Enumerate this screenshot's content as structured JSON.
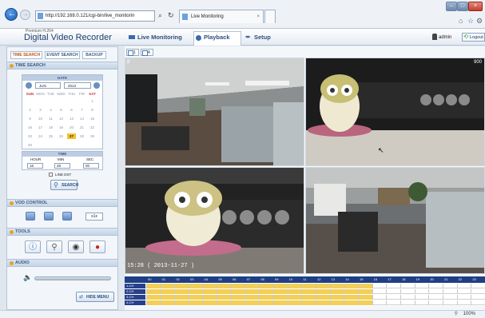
{
  "browser": {
    "url": "http://192.168.0.121/cgi-bin/live_monitorin",
    "tab_title": "Live Monitoring",
    "zoom": "100%"
  },
  "app": {
    "brand_small": "Premium H.264",
    "brand": "Digital Video Recorder",
    "nav": [
      "Live Monitoring",
      "Playback",
      "Setup"
    ],
    "user": "admin",
    "logout": "Logout"
  },
  "left": {
    "tabs": [
      "TIME SEARCH",
      "EVENT SEARCH",
      "BACKUP"
    ],
    "time_search_title": "TIME SEARCH",
    "date_title": "DATE",
    "month": "JUN",
    "year": "2013",
    "weekdays": [
      "SUN",
      "MON",
      "TUE",
      "WED",
      "THU",
      "FRI",
      "SAT"
    ],
    "days": [
      "",
      "",
      "",
      "",
      "",
      "",
      "1",
      "2",
      "3",
      "4",
      "5",
      "6",
      "7",
      "8",
      "9",
      "10",
      "11",
      "12",
      "13",
      "14",
      "15",
      "16",
      "17",
      "18",
      "19",
      "20",
      "21",
      "22",
      "23",
      "24",
      "25",
      "26",
      "27",
      "28",
      "29",
      "30"
    ],
    "selected_day": "27",
    "time_title": "TIME",
    "hour_label": "HOUR",
    "min_label": "MIN",
    "sec_label": "SEC",
    "hour": "16",
    "min": "28",
    "sec": "00",
    "line_dst": "LINE DST",
    "search_btn": "SEARCH",
    "vod_title": "VOD CONTROL",
    "vod_speed": "x1x",
    "tools_title": "TOOLS",
    "audio_title": "AUDIO",
    "hide_menu": "HIDE MENU"
  },
  "video": {
    "view_tabs": [
      "1",
      "4"
    ],
    "cam1_label": "8",
    "cam2_label": "900",
    "timestamp": "15:28 ( 2013-11-27 )"
  },
  "timeline": {
    "hours": [
      "00",
      "01",
      "02",
      "03",
      "04",
      "05",
      "06",
      "07",
      "08",
      "09",
      "10",
      "11",
      "12",
      "13",
      "14",
      "15",
      "16",
      "17",
      "18",
      "19",
      "20",
      "21",
      "22",
      "23"
    ],
    "channels": [
      "1-CH",
      "2-CH",
      "3-CH",
      "4-CH"
    ],
    "recorded_until_hour": 16
  }
}
